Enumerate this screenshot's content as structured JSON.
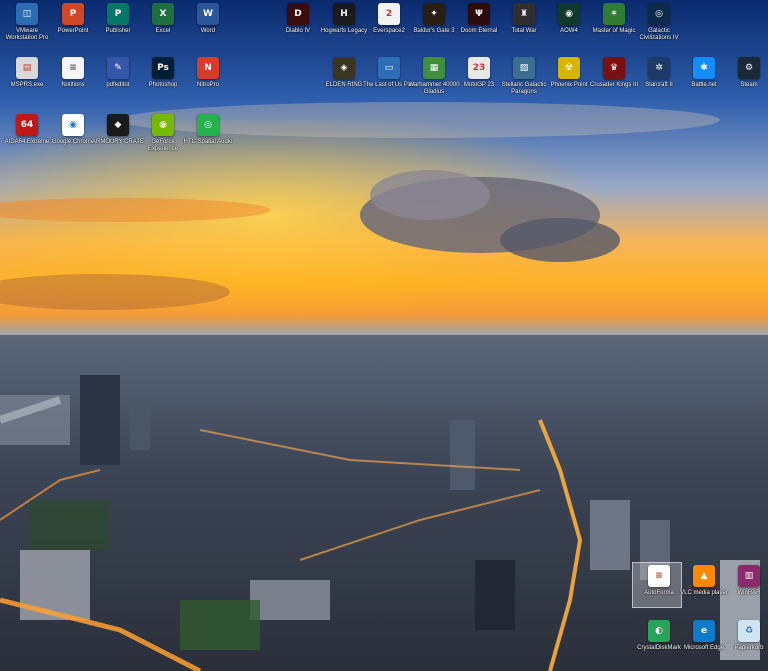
{
  "desktop": {
    "icons": [
      {
        "label": "VMware Workstation Pro",
        "icon": "vmware-icon",
        "bg": "#2b6cb5",
        "glyph": "◫"
      },
      {
        "label": "PowerPoint",
        "icon": "powerpoint-icon",
        "bg": "#d24726",
        "glyph": "P"
      },
      {
        "label": "Publisher",
        "icon": "publisher-icon",
        "bg": "#077568",
        "glyph": "P"
      },
      {
        "label": "Excel",
        "icon": "excel-icon",
        "bg": "#1d6f42",
        "glyph": "X"
      },
      {
        "label": "Word",
        "icon": "word-icon",
        "bg": "#2b579a",
        "glyph": "W"
      },
      {
        "label": "Diablo IV",
        "icon": "diablo-icon",
        "bg": "#3a0c0c",
        "glyph": "D"
      },
      {
        "label": "Hogwarts Legacy",
        "icon": "hogwarts-icon",
        "bg": "#1a1a1a",
        "glyph": "H"
      },
      {
        "label": "Everspace2",
        "icon": "everspace-icon",
        "bg": "#f2f2f2",
        "glyph": "2"
      },
      {
        "label": "Baldur's Gate 3",
        "icon": "baldurs-gate-icon",
        "bg": "#2a1d14",
        "glyph": "✦"
      },
      {
        "label": "Doom Eternal",
        "icon": "doom-icon",
        "bg": "#2d0b0b",
        "glyph": "Ψ"
      },
      {
        "label": "Total War",
        "icon": "total-war-icon",
        "bg": "#2e2e2e",
        "glyph": "♜"
      },
      {
        "label": "AOW4",
        "icon": "aow4-icon",
        "bg": "#123a2a",
        "glyph": "◉"
      },
      {
        "label": "Master of Magic",
        "icon": "master-of-magic-icon",
        "bg": "#2e7d32",
        "glyph": "✶"
      },
      {
        "label": "Galactic Civilizations IV",
        "icon": "galciv-icon",
        "bg": "#0e2a4a",
        "glyph": "◎"
      },
      {
        "label": "MSPRS.exe",
        "icon": "exe-icon",
        "bg": "#d8d8d8",
        "glyph": "▤"
      },
      {
        "label": "Notitions",
        "icon": "document-icon",
        "bg": "#f5f5f5",
        "glyph": "≡"
      },
      {
        "label": "pdfeditor",
        "icon": "pdf-editor-icon",
        "bg": "#3556a8",
        "glyph": "✎"
      },
      {
        "label": "Photoshop",
        "icon": "photoshop-icon",
        "bg": "#001e36",
        "glyph": "Ps"
      },
      {
        "label": "NitroPro",
        "icon": "nitro-icon",
        "bg": "#d93b2b",
        "glyph": "N"
      },
      {
        "label": "ELDEN RING",
        "icon": "elden-ring-icon",
        "bg": "#3b3522",
        "glyph": "◈"
      },
      {
        "label": "The Last of Us Part",
        "icon": "last-of-us-icon",
        "bg": "#2d6fb6",
        "glyph": "▭"
      },
      {
        "label": "Warhammer 40000 Gladius",
        "icon": "warhammer-icon",
        "bg": "#3f8f3f",
        "glyph": "▦"
      },
      {
        "label": "MotoGP 23",
        "icon": "motogp-icon",
        "bg": "#e8e8e8",
        "glyph": "23"
      },
      {
        "label": "Stellaric Galactic Paragons",
        "icon": "stellaris-icon",
        "bg": "#3a6f8f",
        "glyph": "▨"
      },
      {
        "label": "Phoenix Point",
        "icon": "phoenix-point-icon",
        "bg": "#d6b400",
        "glyph": "☢"
      },
      {
        "label": "Crusader Kings III",
        "icon": "crusader-kings-icon",
        "bg": "#7a1010",
        "glyph": "♛"
      },
      {
        "label": "Starcraft II",
        "icon": "starcraft-icon",
        "bg": "#1d3a66",
        "glyph": "✲"
      },
      {
        "label": "Battle.net",
        "icon": "battlenet-icon",
        "bg": "#148eff",
        "glyph": "✱"
      },
      {
        "label": "Steam",
        "icon": "steam-icon",
        "bg": "#1b2838",
        "glyph": "⚙"
      },
      {
        "label": "AIDA64 Extreme",
        "icon": "aida64-icon",
        "bg": "#c01818",
        "glyph": "64"
      },
      {
        "label": "Google Chrome",
        "icon": "chrome-icon",
        "bg": "#ffffff",
        "glyph": "◉"
      },
      {
        "label": "ARMOURY CRATE",
        "icon": "armoury-crate-icon",
        "bg": "#1a1a1a",
        "glyph": "◆"
      },
      {
        "label": "GeForce Experience",
        "icon": "geforce-icon",
        "bg": "#76b900",
        "glyph": "◉"
      },
      {
        "label": "HTC Spatial Audio",
        "icon": "spatial-audio-icon",
        "bg": "#23b24b",
        "glyph": "◎"
      },
      {
        "label": "AutoForma",
        "icon": "autoforma-icon",
        "bg": "#ffffff",
        "glyph": "≡"
      },
      {
        "label": "VLC media player",
        "icon": "vlc-icon",
        "bg": "#ff8800",
        "glyph": "▲"
      },
      {
        "label": "WinRAR",
        "icon": "winrar-icon",
        "bg": "#8b2a6a",
        "glyph": "▥"
      },
      {
        "label": "CrystalDiskMark",
        "icon": "crystaldiskmark-icon",
        "bg": "#2aa35a",
        "glyph": "◐"
      },
      {
        "label": "Microsoft Edge",
        "icon": "edge-icon",
        "bg": "#0f7bc8",
        "glyph": "e"
      },
      {
        "label": "Papierkorb",
        "icon": "recycle-bin-icon",
        "bg": "#cfe3f0",
        "glyph": "♻"
      }
    ]
  }
}
